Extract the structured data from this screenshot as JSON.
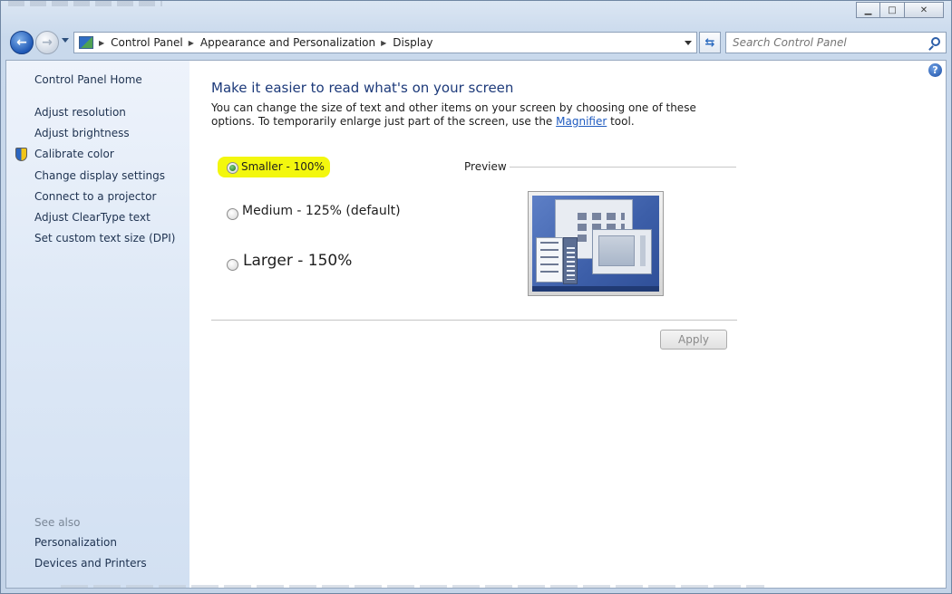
{
  "window": {
    "caption_buttons": {
      "minimize": "▁",
      "maximize": "□",
      "close": "✕"
    }
  },
  "nav": {
    "back_icon": "back-arrow-icon",
    "forward_icon": "forward-arrow-icon",
    "breadcrumbs": [
      "Control Panel",
      "Appearance and Personalization",
      "Display"
    ],
    "refresh_glyph": "⇆",
    "search": {
      "placeholder": "Search Control Panel",
      "value": ""
    }
  },
  "sidebar": {
    "home": "Control Panel Home",
    "items": [
      "Adjust resolution",
      "Adjust brightness",
      "Calibrate color",
      "Change display settings",
      "Connect to a projector",
      "Adjust ClearType text",
      "Set custom text size (DPI)"
    ],
    "see_also_title": "See also",
    "see_also": [
      "Personalization",
      "Devices and Printers"
    ]
  },
  "main": {
    "help_glyph": "?",
    "heading": "Make it easier to read what's on your screen",
    "description_before": "You can change the size of text and other items on your screen by choosing one of these options. To temporarily enlarge just part of the screen, use the ",
    "description_link": "Magnifier",
    "description_after": " tool.",
    "options": [
      {
        "label": "Smaller - 100%",
        "checked": true
      },
      {
        "label": "Medium - 125% (default)",
        "checked": false
      },
      {
        "label": "Larger - 150%",
        "checked": false
      }
    ],
    "preview_label": "Preview",
    "apply_label": "Apply"
  },
  "colors": {
    "heading": "#1d3a7a",
    "link": "#1f5bc0",
    "highlight": "#f3f70e",
    "sidebar_text": "#1e3250"
  }
}
